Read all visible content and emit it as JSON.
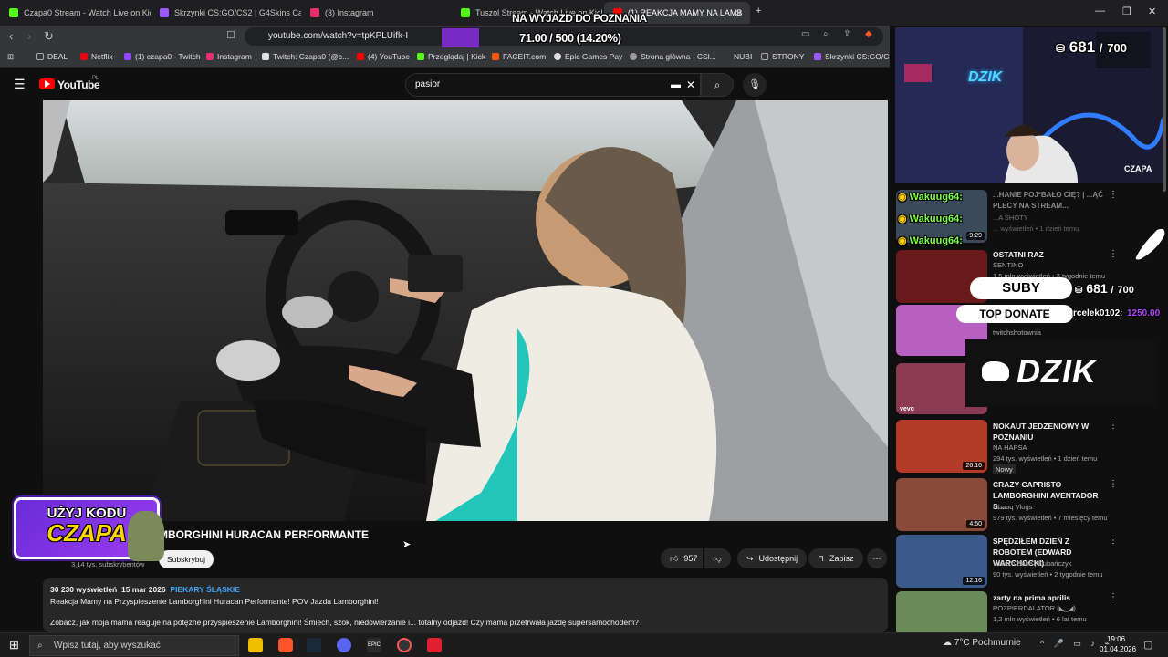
{
  "tabs": [
    {
      "label": "Czapa0 Stream - Watch Live on Kick",
      "color": "#53fc18"
    },
    {
      "label": "Skrzynki CS:GO/CS2 | G4Skins Case o",
      "color": "#9b59ff"
    },
    {
      "label": "(3) Instagram",
      "color": "#e1306c"
    },
    {
      "label": "Tuszol Stream - Watch Live on Kick",
      "color": "#53fc18"
    },
    {
      "label": "(1) REAKCJA MAMY NA LAMB",
      "color": "#ff0000"
    }
  ],
  "address": {
    "url": "youtube.com/watch?v=tpKPLUifk-I"
  },
  "bookmarks": [
    {
      "label": "DEAL",
      "color": "#aaaaaa"
    },
    {
      "label": "Netflix",
      "color": "#e50914"
    },
    {
      "label": "(1) czapa0 - Twitch",
      "color": "#9146ff"
    },
    {
      "label": "Instagram",
      "color": "#e1306c"
    },
    {
      "label": "Twitch: Czapa0 (@c...",
      "color": "#dddddd"
    },
    {
      "label": "(4) YouTube",
      "color": "#ff0000"
    },
    {
      "label": "Przeglądaj | Kick",
      "color": "#53fc18"
    },
    {
      "label": "FACEIT.com",
      "color": "#ff5500"
    },
    {
      "label": "Epic Games Pay",
      "color": "#dddddd"
    },
    {
      "label": "Strona główna - CSl...",
      "color": "#aaaaaa"
    },
    {
      "label": "NUBI",
      "color": "#aaaaaa"
    },
    {
      "label": "STRONY",
      "color": "#aaaaaa"
    },
    {
      "label": "Skrzynki CS:GO/CS2",
      "color": "#9b59ff"
    }
  ],
  "youtube": {
    "logo": "YouTube",
    "region": "PL",
    "search_value": "pasior",
    "video_title": "MBORGHINI HURACAN PERFORMANTE",
    "subscribers": "3,14 tys. subskrybentów",
    "subscribe_label": "Subskrybuj",
    "likes": "957",
    "share_label": "Udostępnij",
    "save_label": "Zapisz",
    "views": "30 230 wyświetleń",
    "date": "15 mar 2026",
    "location": "PIEKARY ŚLĄSKIE",
    "desc_line1": "Reakcja Mamy na Przyspieszenie Lamborghini Huracan Performante! POV Jazda Lamborghini!",
    "desc_line2": "Zobacz, jak moja mama reaguje na potężne przyspieszenie Lamborghini! Śmiech, szok, niedowierzanie i... totalny odjazd! Czy mama przetrwała jazdę supersamochodem?"
  },
  "recommendations": [
    {
      "title": "...HANIE POJ*BAŁO CIĘ? | ...ĄĆ PLECY NA STREAM...",
      "channel": "...A SHOTY",
      "meta": "... wyświetleń • 1 dzień temu",
      "duration": "9:29"
    },
    {
      "title": "OSTATNI RAZ",
      "channel": "SENTINO",
      "meta": "1,5 mln wyświetleń • 3 tygodnie temu",
      "duration": ""
    },
    {
      "title": "",
      "channel": "twitchshotownia",
      "meta": "",
      "duration": ""
    },
    {
      "title": "",
      "channel": "",
      "meta": "",
      "duration": ""
    },
    {
      "title": "NOKAUT JEDZENIOWY W POZNANIU",
      "channel": "NA HAPSA",
      "meta": "294 tys. wyświetleń • 1 dzień temu",
      "badge": "Nowy",
      "duration": "26:16"
    },
    {
      "title": "CRAZY CAPRISTO LAMBORGHINI AVENTADOR S...",
      "channel": "Ishaaq Vlogs",
      "meta": "979 tys. wyświetleń • 7 miesięcy temu",
      "duration": "4:50"
    },
    {
      "title": "SPĘDZIŁEM DZIEŃ Z ROBOTEM (EDWARD WARCHOCKI)",
      "channel": "Wake'n Bake | Kubańczyk",
      "meta": "90 tys. wyświetleń • 2 tygodnie temu",
      "duration": "12:16"
    },
    {
      "title": "zarty na prima aprilis",
      "channel": "ROZPIERDALATOR (◣_◢)",
      "meta": "1,2 mln wyświetleń • 6 lat temu",
      "duration": ""
    }
  ],
  "overlay": {
    "top_goal": "NA WYJAZD DO POZNANIA",
    "top_progress": "71.00 / 500 (14.20%)",
    "progress_fraction": 0.142,
    "sub_count_top": "681",
    "sub_goal_top": "700",
    "suby_label": "SUBY",
    "sub_count": "681",
    "sub_goal": "700",
    "top_donate_label": "TOP DONATE",
    "top_donate_name": "rcelek0102:",
    "top_donate_amount": "1250.00",
    "chat_names": [
      "Wakuug64:",
      "Wakuug64:",
      "Wakuug64:"
    ],
    "dzik_small": "DZIK",
    "dzik_big": "DZIK",
    "cam_name": "CZAPA",
    "promo_line1": "UŻYJ KODU",
    "promo_line2": "CZAPA"
  },
  "taskbar": {
    "search_placeholder": "Wpisz tutaj, aby wyszukać",
    "weather": "7°C  Pochmurnie",
    "time": "19:06",
    "date": "01.04.2026"
  }
}
